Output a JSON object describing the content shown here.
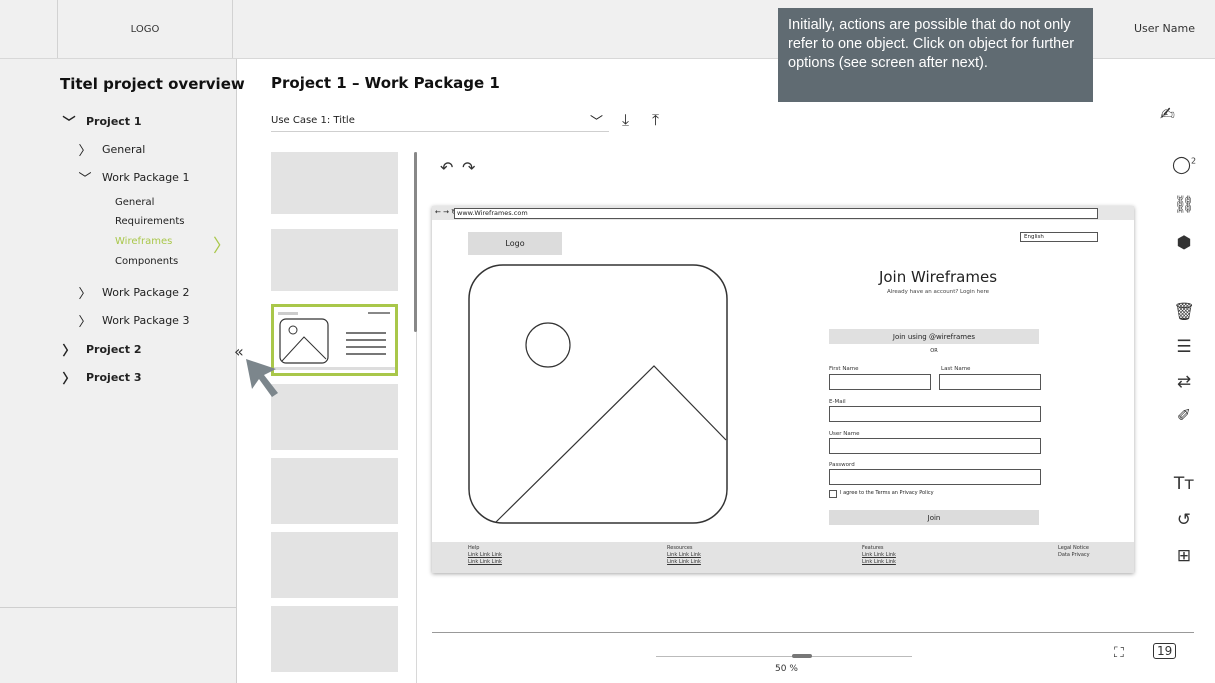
{
  "header": {
    "logo": "LOGO",
    "user_name": "User Name"
  },
  "tooltip": {
    "text": "Initially, actions are possible that do not only refer to one object. Click on object for further options (see screen after next)."
  },
  "sidebar": {
    "title": "Titel project overview",
    "project1": "Project 1",
    "general": "General",
    "wp1": "Work Package 1",
    "wp1_items": [
      "General",
      "Requirements",
      "Wireframes",
      "Components"
    ],
    "wp2": "Work Package 2",
    "wp3": "Work Package 3",
    "project2": "Project 2",
    "project3": "Project 3",
    "active_item": "Wireframes",
    "accent_color": "#a9c74a"
  },
  "main": {
    "title": "Project 1 – Work Package 1",
    "use_case": "Use Case 1: Title",
    "zoom": "50 %"
  },
  "wireframe": {
    "url": "www.Wireframes.com",
    "logo": "Logo",
    "language": "English",
    "title": "Join Wireframes",
    "subtitle": "Already have an account? Login here",
    "join_using": "Join using @wireframes",
    "or": "OR",
    "first_name": "First Name",
    "last_name": "Last Name",
    "email": "E-Mail",
    "user_name": "User Name",
    "password": "Password",
    "agree": "I agree to the Terms an Privacy Policy",
    "join_button": "Join",
    "footer": {
      "help": "Help",
      "resources": "Resources",
      "features": "Features",
      "legal": "Legal Notice",
      "privacy": "Data Privacy",
      "links": "Link Link Link"
    }
  },
  "right_toolbar": {
    "comment_count": "2"
  },
  "icons": [
    "chevron-down-icon",
    "download-icon",
    "upload-icon",
    "undo-icon",
    "redo-icon",
    "comment-icon",
    "link-icon",
    "cube-icon",
    "trash-icon",
    "list-icon",
    "swap-icon",
    "brush-icon",
    "text-size-icon",
    "history-icon",
    "add-layer-icon",
    "fullscreen-icon",
    "pages-icon",
    "checklist-icon",
    "collapse-icon",
    "cursor-icon"
  ],
  "colors": {
    "accent": "#a9c74a",
    "tooltip_bg": "#606b72",
    "panel_bg": "#f0f0f0"
  }
}
